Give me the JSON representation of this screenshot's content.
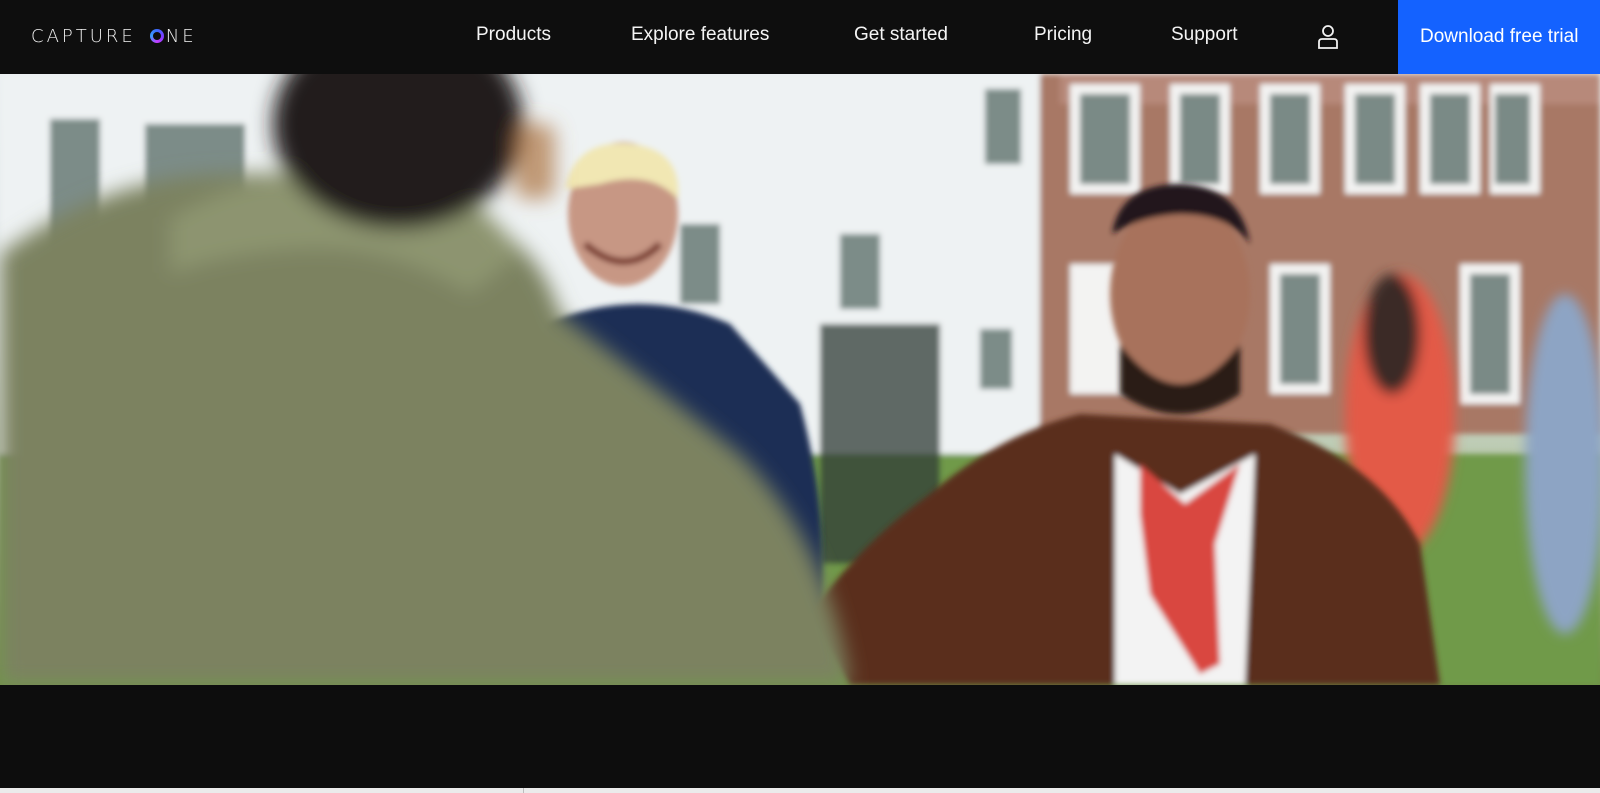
{
  "brand": {
    "logo_prefix": "CAPTURE",
    "logo_suffix": "NE"
  },
  "nav": {
    "items": [
      {
        "label": "Products"
      },
      {
        "label": "Explore features"
      },
      {
        "label": "Get started"
      },
      {
        "label": "Pricing"
      },
      {
        "label": "Support"
      }
    ],
    "account_icon": "user-icon",
    "cta_label": "Download free trial"
  },
  "hero": {
    "media": "photo of people greeting on a lawn in front of buildings",
    "scroll_icon": "chevron-down-icon"
  },
  "colors": {
    "nav_background": "#0e0e0e",
    "cta_background": "#1462ff",
    "page_background": "#0d0d0d"
  }
}
